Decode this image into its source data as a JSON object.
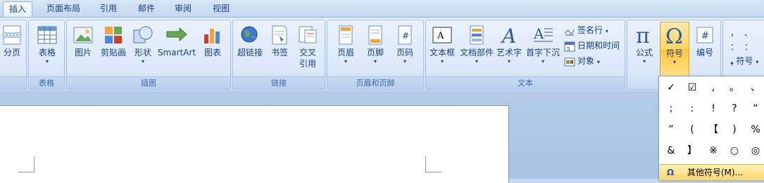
{
  "tabs": [
    "插入",
    "页面布局",
    "引用",
    "邮件",
    "审阅",
    "视图"
  ],
  "groups": {
    "left_partial_label": "",
    "table": "表格",
    "illustrations": "插图",
    "links": "链接",
    "header_footer": "页眉和页脚",
    "text": "文本"
  },
  "buttons": {
    "page_break": "分页",
    "table": "表格",
    "picture": "图片",
    "clipart": "剪贴画",
    "shapes": "形状",
    "smartart": "SmartArt",
    "chart": "图表",
    "hyperlink": "超链接",
    "bookmark": "书签",
    "crossref_1": "交叉",
    "crossref_2": "引用",
    "header": "页眉",
    "footer": "页脚",
    "page_number": "页码",
    "textbox": "文本框",
    "quickparts": "文档部件",
    "wordart": "艺术字",
    "dropcap": "首字下沉",
    "signature_line": "签名行",
    "date_time": "日期和时间",
    "object": "对象",
    "equation": "公式",
    "symbol": "符号",
    "numbering": "编号",
    "symbol_small": "符号"
  },
  "dropdown": {
    "symbols": [
      "✓",
      "☑",
      ",",
      "。",
      "、",
      ";",
      ":",
      "!",
      "?",
      "“",
      "”",
      "(",
      "【",
      ")",
      "%",
      "&",
      "】",
      "※",
      "○",
      "◎"
    ],
    "more_symbols": "其他符号(M)..."
  },
  "special_chars_partial": [
    "，",
    "、",
    "：",
    "：",
    "·"
  ],
  "colors": {
    "ribbon_bg": "#dbe8f8",
    "highlight": "#ffd65e",
    "text": "#15428b"
  }
}
